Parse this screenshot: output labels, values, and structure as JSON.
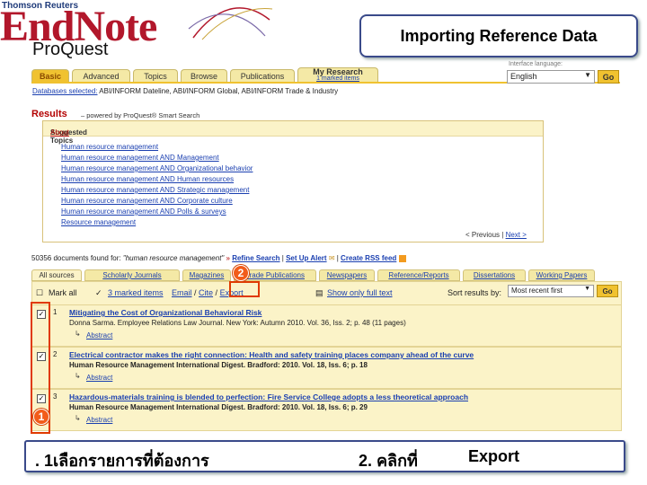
{
  "header": {
    "vendor": "Thomson Reuters",
    "logo_text": "EndNote",
    "slide_title": "Importing Reference Data",
    "db_logo": "ProQuest"
  },
  "nav": {
    "tabs": [
      "Basic",
      "Advanced",
      "Topics",
      "Browse",
      "Publications",
      "My Research"
    ],
    "my_research_sub": "1 marked items",
    "interface_language_label": "Interface language:",
    "language": "English",
    "go": "Go"
  },
  "databases": {
    "label": "Databases selected:",
    "value": "ABI/INFORM Dateline, ABI/INFORM Global, ABI/INFORM Trade & Industry"
  },
  "results": {
    "heading": "Results",
    "powered": "– powered by ProQuest® Smart Search",
    "suggested_label": "Suggested Topics",
    "about": "About",
    "topics": [
      "Human resource management",
      "Human resource management AND Management",
      "Human resource management AND Organizational behavior",
      "Human resource management AND Human resources",
      "Human resource management AND Strategic management",
      "Human resource management AND Corporate culture",
      "Human resource management AND Polls & surveys",
      "Resource management"
    ],
    "previous": "< Previous",
    "next": "Next >"
  },
  "found": {
    "count_text": "50356 documents found for:",
    "query": "\"human resource management\"",
    "refine": "Refine Search",
    "alert": "Set Up Alert",
    "rss": "Create RSS feed"
  },
  "source_tabs": [
    "All sources",
    "Scholarly Journals",
    "Magazines",
    "Trade Publications",
    "Newspapers",
    "Reference/Reports",
    "Dissertations",
    "Working Papers"
  ],
  "toolbar": {
    "mark_all": "Mark all",
    "marked_items": "3 marked items",
    "email": "Email",
    "cite": "Cite",
    "export": "Export",
    "full_text": "Show only full text",
    "sort_label": "Sort results by:",
    "sort_value": "Most recent first",
    "go": "Go"
  },
  "items": [
    {
      "num": "1",
      "title": "Mitigating the Cost of Organizational Behavioral Risk",
      "meta": "Donna Sarma. Employee Relations Law Journal. New York: Autumn 2010. Vol. 36, Iss. 2; p. 48 (11 pages)",
      "abstract": "Abstract"
    },
    {
      "num": "2",
      "title": "Electrical contractor makes the right connection: Health and safety training places company ahead of the curve",
      "meta": "Human Resource Management International Digest. Bradford: 2010. Vol. 18, Iss. 6; p. 18",
      "abstract": "Abstract"
    },
    {
      "num": "3",
      "title": "Hazardous-materials training is blended to perfection: Fire Service College adopts a less theoretical approach",
      "meta": "Human Resource Management International Digest. Bradford: 2010. Vol. 18, Iss. 6; p. 29",
      "abstract": "Abstract"
    }
  ],
  "callouts": {
    "one": "1",
    "two": "2"
  },
  "caption": {
    "step1": ". 1เลือกรายการที่ต้องการ",
    "step2": "2. คลิกที่",
    "export_word": "Export"
  },
  "colors": {
    "accent": "#f0c230",
    "brand_red": "#b2172b",
    "callout": "#f25c1a"
  }
}
